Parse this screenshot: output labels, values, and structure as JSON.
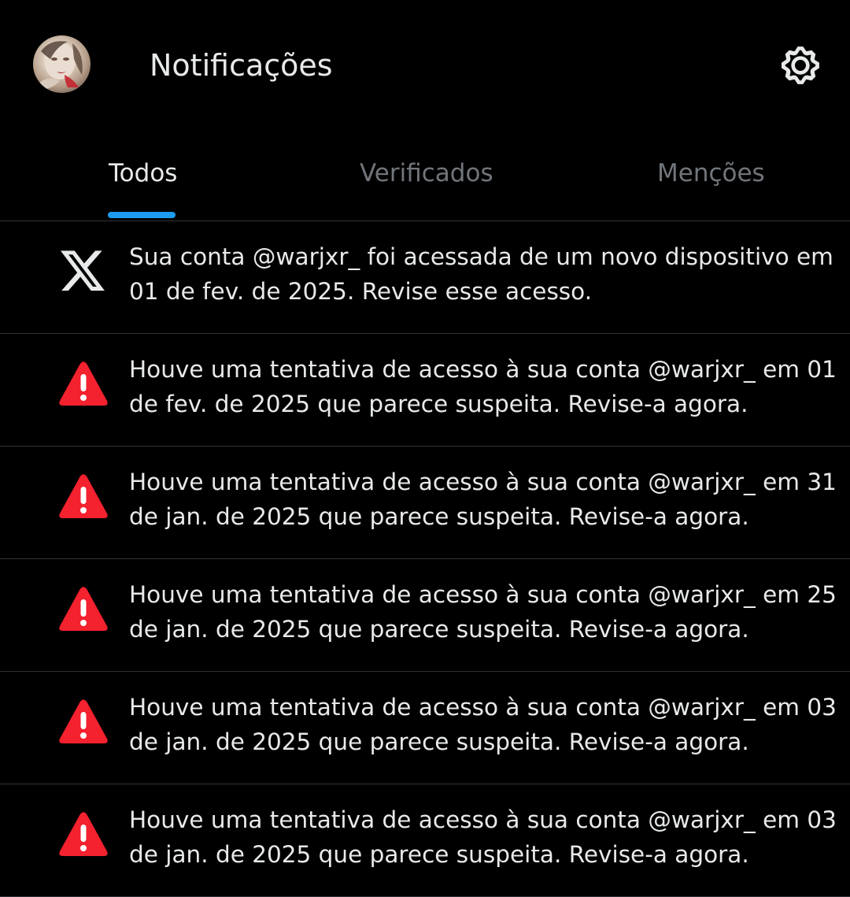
{
  "header": {
    "title": "Notificações",
    "avatar_icon": "avatar-photo",
    "settings_icon": "gear-icon"
  },
  "tabs": [
    {
      "label": "Todos",
      "active": true
    },
    {
      "label": "Verificados",
      "active": false
    },
    {
      "label": "Menções",
      "active": false
    }
  ],
  "colors": {
    "background": "#000000",
    "text_primary": "#e7e9ea",
    "text_secondary": "#71767b",
    "accent": "#1d9bf0",
    "alert": "#f4212e",
    "divider": "#2f3336"
  },
  "notifications": [
    {
      "icon": "x-logo-icon",
      "text": "Sua conta @warjxr_ foi acessada de um novo dispositivo em 01 de fev. de 2025. Revise esse acesso."
    },
    {
      "icon": "warning-icon",
      "text": "Houve uma tentativa de acesso à sua conta @warjxr_ em 01 de fev. de 2025 que parece suspeita. Revise-a agora."
    },
    {
      "icon": "warning-icon",
      "text": "Houve uma tentativa de acesso à sua conta @warjxr_ em 31 de jan. de 2025 que parece suspeita. Revise-a agora."
    },
    {
      "icon": "warning-icon",
      "text": "Houve uma tentativa de acesso à sua conta @warjxr_ em 25 de jan. de 2025 que parece suspeita. Revise-a agora."
    },
    {
      "icon": "warning-icon",
      "text": "Houve uma tentativa de acesso à sua conta @warjxr_ em 03 de jan. de 2025 que parece suspeita. Revise-a agora."
    },
    {
      "icon": "warning-icon",
      "text": "Houve uma tentativa de acesso à sua conta @warjxr_ em 03 de jan. de 2025 que parece suspeita. Revise-a agora."
    }
  ]
}
